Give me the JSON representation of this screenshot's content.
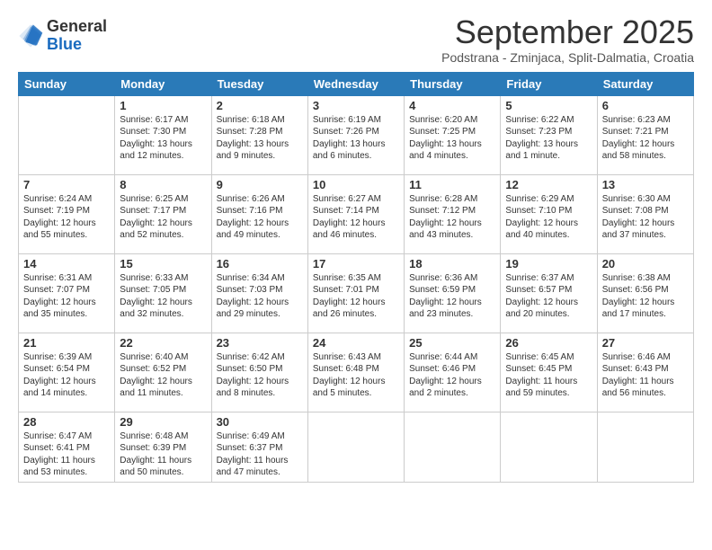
{
  "logo": {
    "general": "General",
    "blue": "Blue"
  },
  "header": {
    "month": "September 2025",
    "location": "Podstrana - Zminjaca, Split-Dalmatia, Croatia"
  },
  "weekdays": [
    "Sunday",
    "Monday",
    "Tuesday",
    "Wednesday",
    "Thursday",
    "Friday",
    "Saturday"
  ],
  "weeks": [
    [
      {
        "day": "",
        "info": ""
      },
      {
        "day": "1",
        "info": "Sunrise: 6:17 AM\nSunset: 7:30 PM\nDaylight: 13 hours\nand 12 minutes."
      },
      {
        "day": "2",
        "info": "Sunrise: 6:18 AM\nSunset: 7:28 PM\nDaylight: 13 hours\nand 9 minutes."
      },
      {
        "day": "3",
        "info": "Sunrise: 6:19 AM\nSunset: 7:26 PM\nDaylight: 13 hours\nand 6 minutes."
      },
      {
        "day": "4",
        "info": "Sunrise: 6:20 AM\nSunset: 7:25 PM\nDaylight: 13 hours\nand 4 minutes."
      },
      {
        "day": "5",
        "info": "Sunrise: 6:22 AM\nSunset: 7:23 PM\nDaylight: 13 hours\nand 1 minute."
      },
      {
        "day": "6",
        "info": "Sunrise: 6:23 AM\nSunset: 7:21 PM\nDaylight: 12 hours\nand 58 minutes."
      }
    ],
    [
      {
        "day": "7",
        "info": "Sunrise: 6:24 AM\nSunset: 7:19 PM\nDaylight: 12 hours\nand 55 minutes."
      },
      {
        "day": "8",
        "info": "Sunrise: 6:25 AM\nSunset: 7:17 PM\nDaylight: 12 hours\nand 52 minutes."
      },
      {
        "day": "9",
        "info": "Sunrise: 6:26 AM\nSunset: 7:16 PM\nDaylight: 12 hours\nand 49 minutes."
      },
      {
        "day": "10",
        "info": "Sunrise: 6:27 AM\nSunset: 7:14 PM\nDaylight: 12 hours\nand 46 minutes."
      },
      {
        "day": "11",
        "info": "Sunrise: 6:28 AM\nSunset: 7:12 PM\nDaylight: 12 hours\nand 43 minutes."
      },
      {
        "day": "12",
        "info": "Sunrise: 6:29 AM\nSunset: 7:10 PM\nDaylight: 12 hours\nand 40 minutes."
      },
      {
        "day": "13",
        "info": "Sunrise: 6:30 AM\nSunset: 7:08 PM\nDaylight: 12 hours\nand 37 minutes."
      }
    ],
    [
      {
        "day": "14",
        "info": "Sunrise: 6:31 AM\nSunset: 7:07 PM\nDaylight: 12 hours\nand 35 minutes."
      },
      {
        "day": "15",
        "info": "Sunrise: 6:33 AM\nSunset: 7:05 PM\nDaylight: 12 hours\nand 32 minutes."
      },
      {
        "day": "16",
        "info": "Sunrise: 6:34 AM\nSunset: 7:03 PM\nDaylight: 12 hours\nand 29 minutes."
      },
      {
        "day": "17",
        "info": "Sunrise: 6:35 AM\nSunset: 7:01 PM\nDaylight: 12 hours\nand 26 minutes."
      },
      {
        "day": "18",
        "info": "Sunrise: 6:36 AM\nSunset: 6:59 PM\nDaylight: 12 hours\nand 23 minutes."
      },
      {
        "day": "19",
        "info": "Sunrise: 6:37 AM\nSunset: 6:57 PM\nDaylight: 12 hours\nand 20 minutes."
      },
      {
        "day": "20",
        "info": "Sunrise: 6:38 AM\nSunset: 6:56 PM\nDaylight: 12 hours\nand 17 minutes."
      }
    ],
    [
      {
        "day": "21",
        "info": "Sunrise: 6:39 AM\nSunset: 6:54 PM\nDaylight: 12 hours\nand 14 minutes."
      },
      {
        "day": "22",
        "info": "Sunrise: 6:40 AM\nSunset: 6:52 PM\nDaylight: 12 hours\nand 11 minutes."
      },
      {
        "day": "23",
        "info": "Sunrise: 6:42 AM\nSunset: 6:50 PM\nDaylight: 12 hours\nand 8 minutes."
      },
      {
        "day": "24",
        "info": "Sunrise: 6:43 AM\nSunset: 6:48 PM\nDaylight: 12 hours\nand 5 minutes."
      },
      {
        "day": "25",
        "info": "Sunrise: 6:44 AM\nSunset: 6:46 PM\nDaylight: 12 hours\nand 2 minutes."
      },
      {
        "day": "26",
        "info": "Sunrise: 6:45 AM\nSunset: 6:45 PM\nDaylight: 11 hours\nand 59 minutes."
      },
      {
        "day": "27",
        "info": "Sunrise: 6:46 AM\nSunset: 6:43 PM\nDaylight: 11 hours\nand 56 minutes."
      }
    ],
    [
      {
        "day": "28",
        "info": "Sunrise: 6:47 AM\nSunset: 6:41 PM\nDaylight: 11 hours\nand 53 minutes."
      },
      {
        "day": "29",
        "info": "Sunrise: 6:48 AM\nSunset: 6:39 PM\nDaylight: 11 hours\nand 50 minutes."
      },
      {
        "day": "30",
        "info": "Sunrise: 6:49 AM\nSunset: 6:37 PM\nDaylight: 11 hours\nand 47 minutes."
      },
      {
        "day": "",
        "info": ""
      },
      {
        "day": "",
        "info": ""
      },
      {
        "day": "",
        "info": ""
      },
      {
        "day": "",
        "info": ""
      }
    ]
  ]
}
